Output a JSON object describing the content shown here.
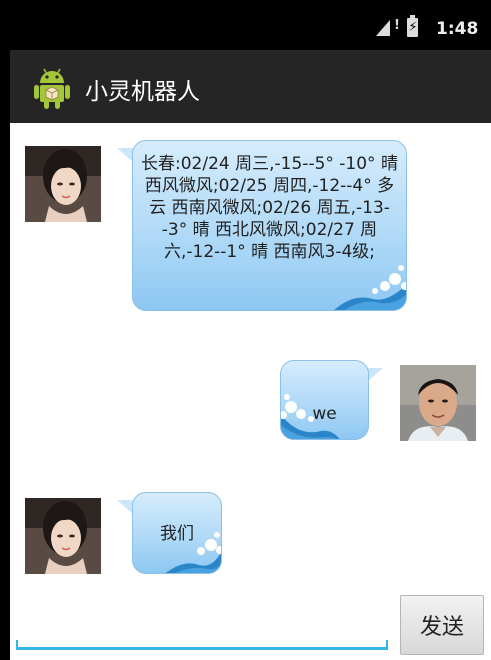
{
  "status_bar": {
    "time": "1:48"
  },
  "app": {
    "title": "小灵机器人"
  },
  "messages": [
    {
      "side": "left",
      "text": "长春:02/24 周三,-15--5° -10° 晴 西风微风;02/25 周四,-12--4° 多云 西南风微风;02/26 周五,-13--3° 晴 西北风微风;02/27 周六,-12--1° 晴 西南风3-4级;"
    },
    {
      "side": "right",
      "text": "we"
    },
    {
      "side": "left",
      "text": "我们"
    }
  ],
  "input": {
    "value": "",
    "placeholder": ""
  },
  "send_button": {
    "label": "发送"
  },
  "colors": {
    "accent": "#33b5e5",
    "bubble": "#a9d6f6",
    "action_bar": "#252525"
  }
}
